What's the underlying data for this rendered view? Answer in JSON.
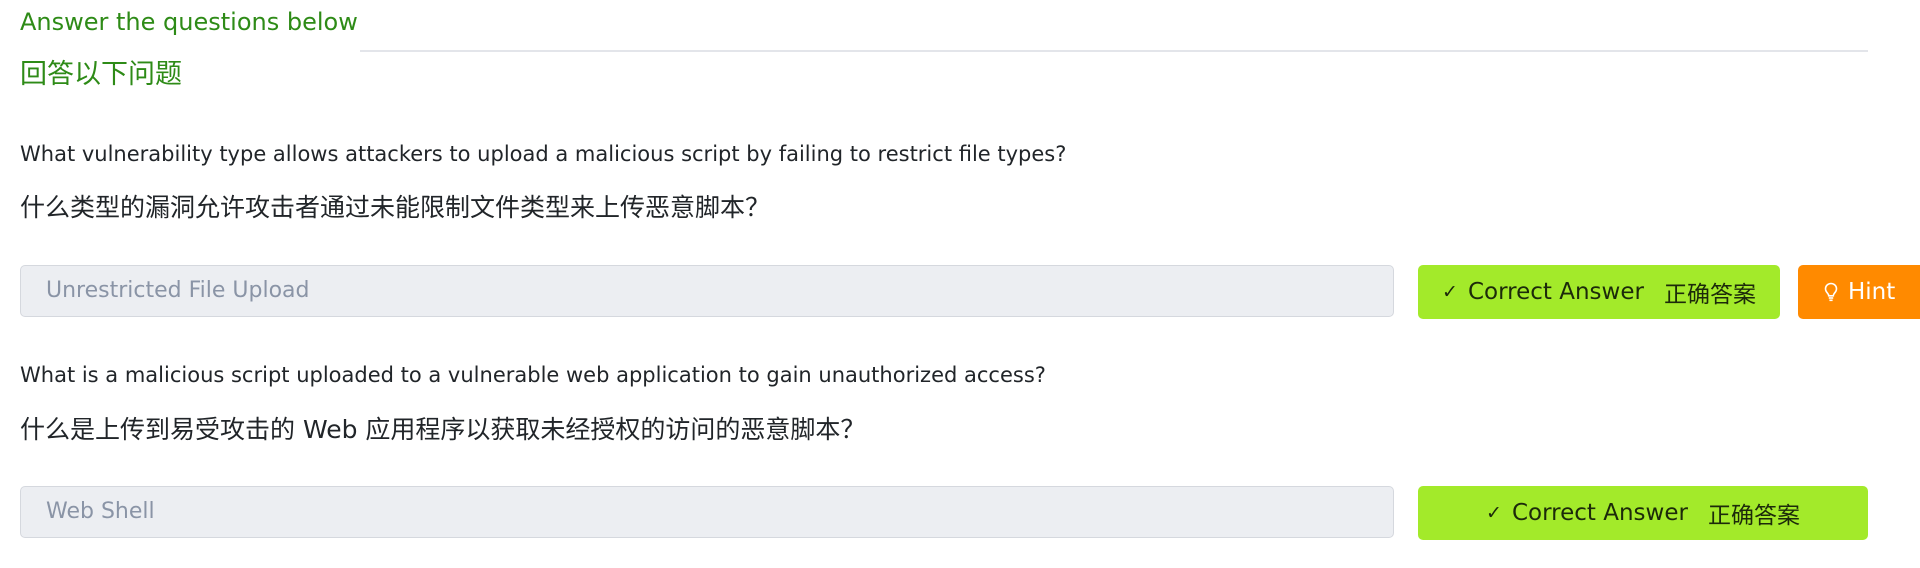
{
  "header": {
    "title_en": "Answer the questions below",
    "title_cn": "回答以下问题"
  },
  "questions": [
    {
      "text_en": "What vulnerability type allows attackers to upload a malicious script by failing to restrict file types?",
      "text_cn": "什么类型的漏洞允许攻击者通过未能限制文件类型来上传恶意脚本？",
      "answer_value": "Unrestricted File Upload",
      "correct_label_en": "Correct Answer",
      "correct_label_cn": "正确答案",
      "check_icon": "✓",
      "hint_label": "Hint",
      "hint_icon": "lightbulb-icon"
    },
    {
      "text_en": "What is a malicious script uploaded to a vulnerable web application to gain unauthorized access?",
      "text_cn": "什么是上传到易受攻击的 Web 应用程序以获取未经授权的访问的恶意脚本？",
      "answer_value": "Web Shell",
      "correct_label_en": "Correct Answer",
      "correct_label_cn": "正确答案",
      "check_icon": "✓"
    }
  ],
  "colors": {
    "heading": "#2e8b17",
    "correct_button": "#a3ea2a",
    "hint_button": "#ff8a00",
    "answer_field_bg": "#eceef2"
  }
}
